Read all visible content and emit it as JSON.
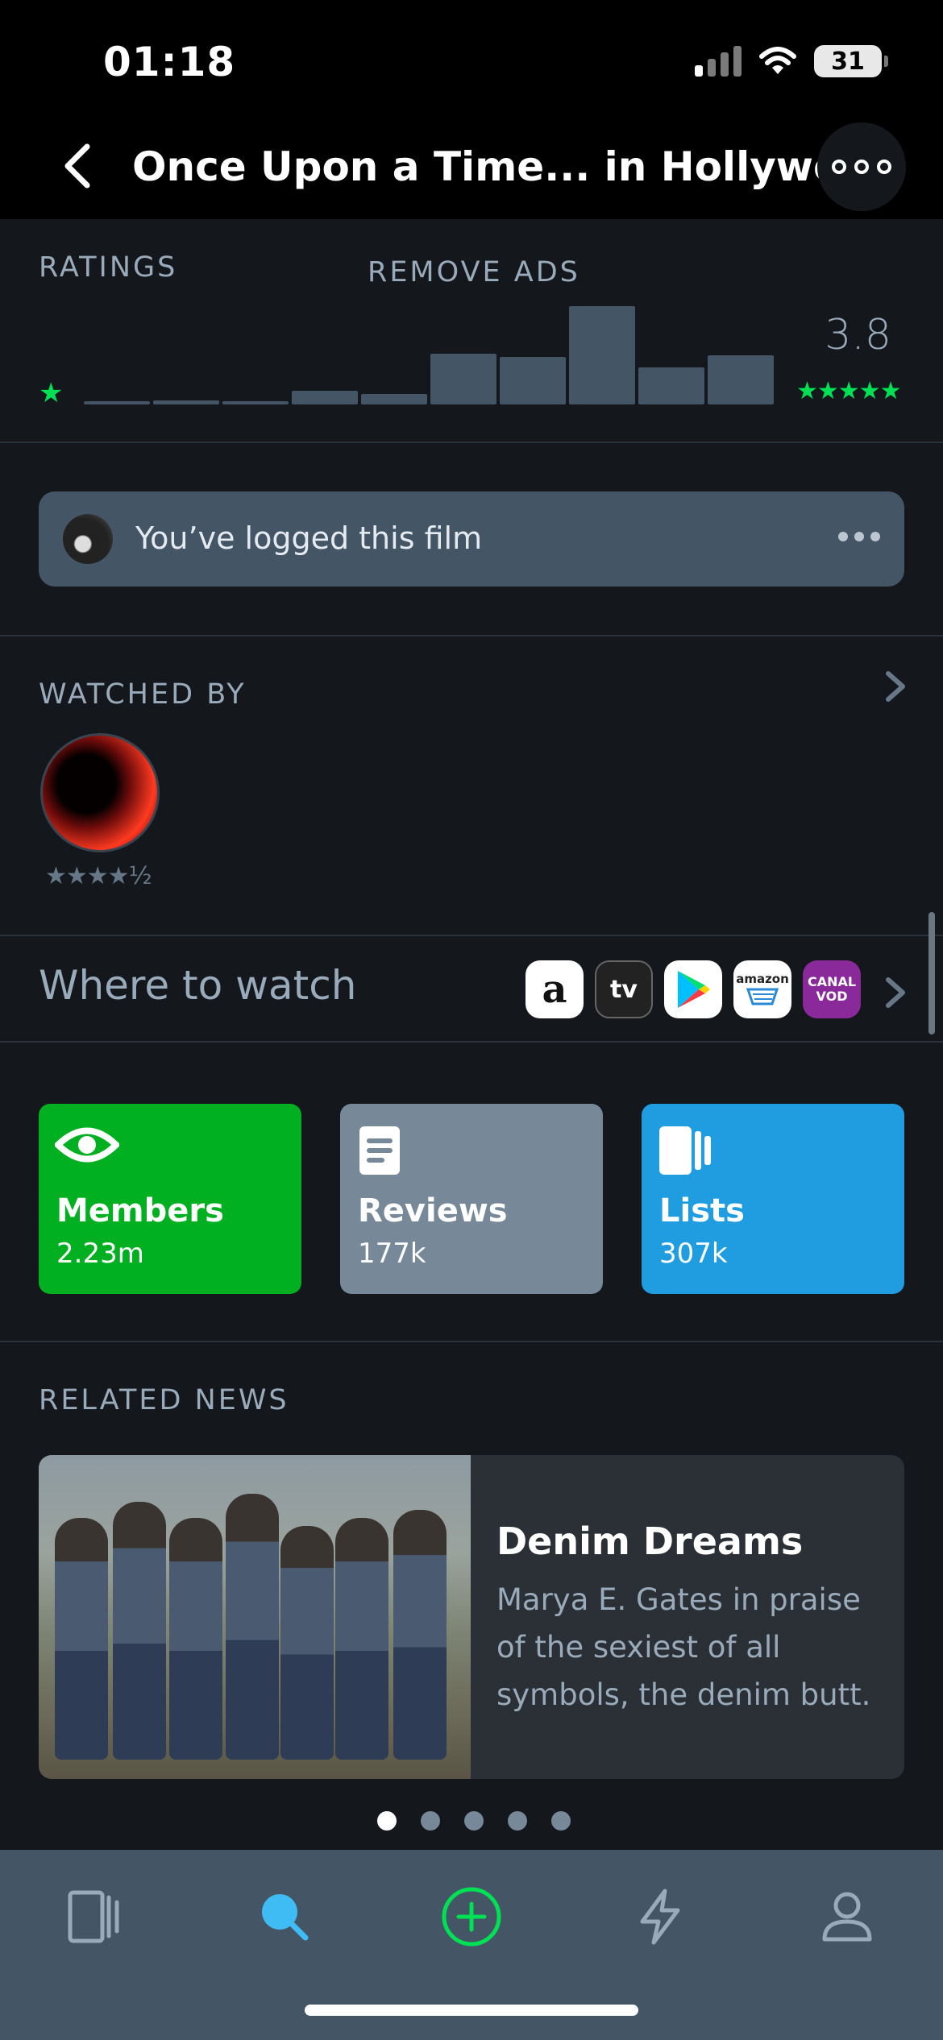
{
  "status_bar": {
    "time": "01:18",
    "battery": "31"
  },
  "header": {
    "title": "Once Upon a Time... in Hollywood"
  },
  "ratings": {
    "label": "RATINGS",
    "remove_ads": "REMOVE ADS",
    "average": "3.8",
    "min_star": "★",
    "max_stars": "★★★★★",
    "histogram_relative": [
      0.03,
      0.04,
      0.03,
      0.14,
      0.11,
      0.52,
      0.48,
      1.0,
      0.38,
      0.5
    ]
  },
  "logged": {
    "text": "You’ve logged this film"
  },
  "watched_by": {
    "label": "WATCHED BY",
    "rating": "★★★★½"
  },
  "where_to_watch": {
    "label": "Where to watch",
    "providers": [
      {
        "icon": "amazon-prime-icon",
        "text": "a"
      },
      {
        "icon": "apple-tv-icon",
        "text": "tv"
      },
      {
        "icon": "google-play-icon",
        "text": ""
      },
      {
        "icon": "amazon-store-icon",
        "text": "amazon"
      },
      {
        "icon": "canal-vod-icon",
        "text1": "CANAL",
        "text2": "VOD"
      }
    ]
  },
  "stats": {
    "members": {
      "label": "Members",
      "count": "2.23m",
      "color": "#00b020"
    },
    "reviews": {
      "label": "Reviews",
      "count": "177k",
      "color": "#778899"
    },
    "lists": {
      "label": "Lists",
      "count": "307k",
      "color": "#209ce0"
    }
  },
  "related_news": {
    "label": "RELATED NEWS",
    "headline": "Denim Dreams",
    "description": "Marya E. Gates in praise of the sexiest of all symbols, the denim butt.",
    "pages": 5,
    "active_page": 1
  },
  "tabbar": {
    "items": [
      {
        "icon": "films-icon",
        "active": false
      },
      {
        "icon": "search-icon",
        "active": true
      },
      {
        "icon": "add-log-icon",
        "active": false
      },
      {
        "icon": "activity-icon",
        "active": false
      },
      {
        "icon": "profile-icon",
        "active": false
      }
    ],
    "colors": {
      "active": "#40bcf4",
      "add": "#00e054",
      "inactive": "#9ab"
    }
  },
  "colors": {
    "background": "#14181c",
    "accent_green": "#00e054",
    "muted": "#99aabb"
  }
}
